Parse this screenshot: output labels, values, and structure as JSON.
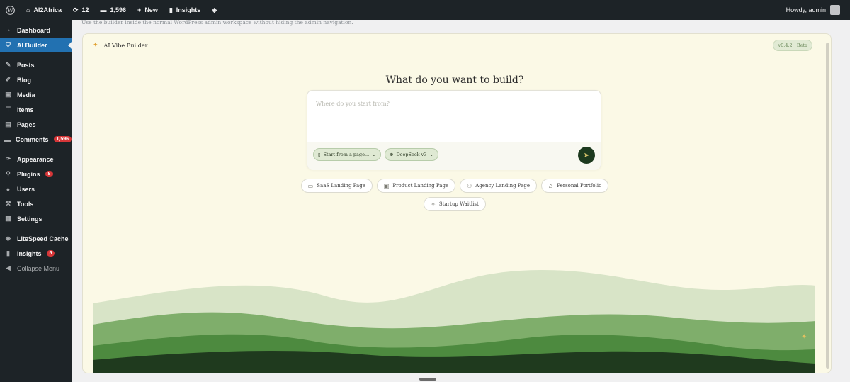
{
  "adminbar": {
    "site_name": "AI2Africa",
    "updates_count": "12",
    "comments_count": "1,596",
    "new_label": "New",
    "insights_label": "Insights",
    "howdy": "Howdy, admin"
  },
  "sidebar": {
    "items": [
      {
        "label": "Dashboard",
        "icon": "dashboard-icon"
      },
      {
        "label": "AI Builder",
        "icon": "shield-icon"
      },
      {
        "label": "Posts",
        "icon": "pin-icon"
      },
      {
        "label": "Blog",
        "icon": "pencil-icon"
      },
      {
        "label": "Media",
        "icon": "media-icon"
      },
      {
        "label": "Items",
        "icon": "pin-icon"
      },
      {
        "label": "Pages",
        "icon": "page-icon"
      },
      {
        "label": "Comments",
        "icon": "comment-icon",
        "badge": "1,596"
      },
      {
        "label": "Appearance",
        "icon": "brush-icon"
      },
      {
        "label": "Plugins",
        "icon": "plug-icon",
        "badge": "8"
      },
      {
        "label": "Users",
        "icon": "user-icon"
      },
      {
        "label": "Tools",
        "icon": "wrench-icon"
      },
      {
        "label": "Settings",
        "icon": "settings-icon"
      },
      {
        "label": "LiteSpeed Cache",
        "icon": "diamond-icon"
      },
      {
        "label": "Insights",
        "icon": "chart-icon",
        "badge": "5"
      },
      {
        "label": "Collapse Menu",
        "icon": "collapse-icon"
      }
    ]
  },
  "notice": "Use the builder inside the normal WordPress admin workspace without hiding the admin navigation.",
  "builder": {
    "title": "AI Vibe Builder",
    "version": "v0.4.2 · Beta",
    "headline": "What do you want to build?",
    "prompt_placeholder": "Where do you start from?",
    "start_chip": "Start from a page...",
    "model_chip": "DeepSeek v3",
    "templates": [
      "SaaS Landing Page",
      "Product Landing Page",
      "Agency Landing Page",
      "Personal Portfolio",
      "Startup Waitlist"
    ]
  },
  "colors": {
    "accent": "#2271b1",
    "admin_dark": "#1d2327",
    "builder_bg": "#fbf9e6",
    "send_button": "#1d3a1f"
  }
}
